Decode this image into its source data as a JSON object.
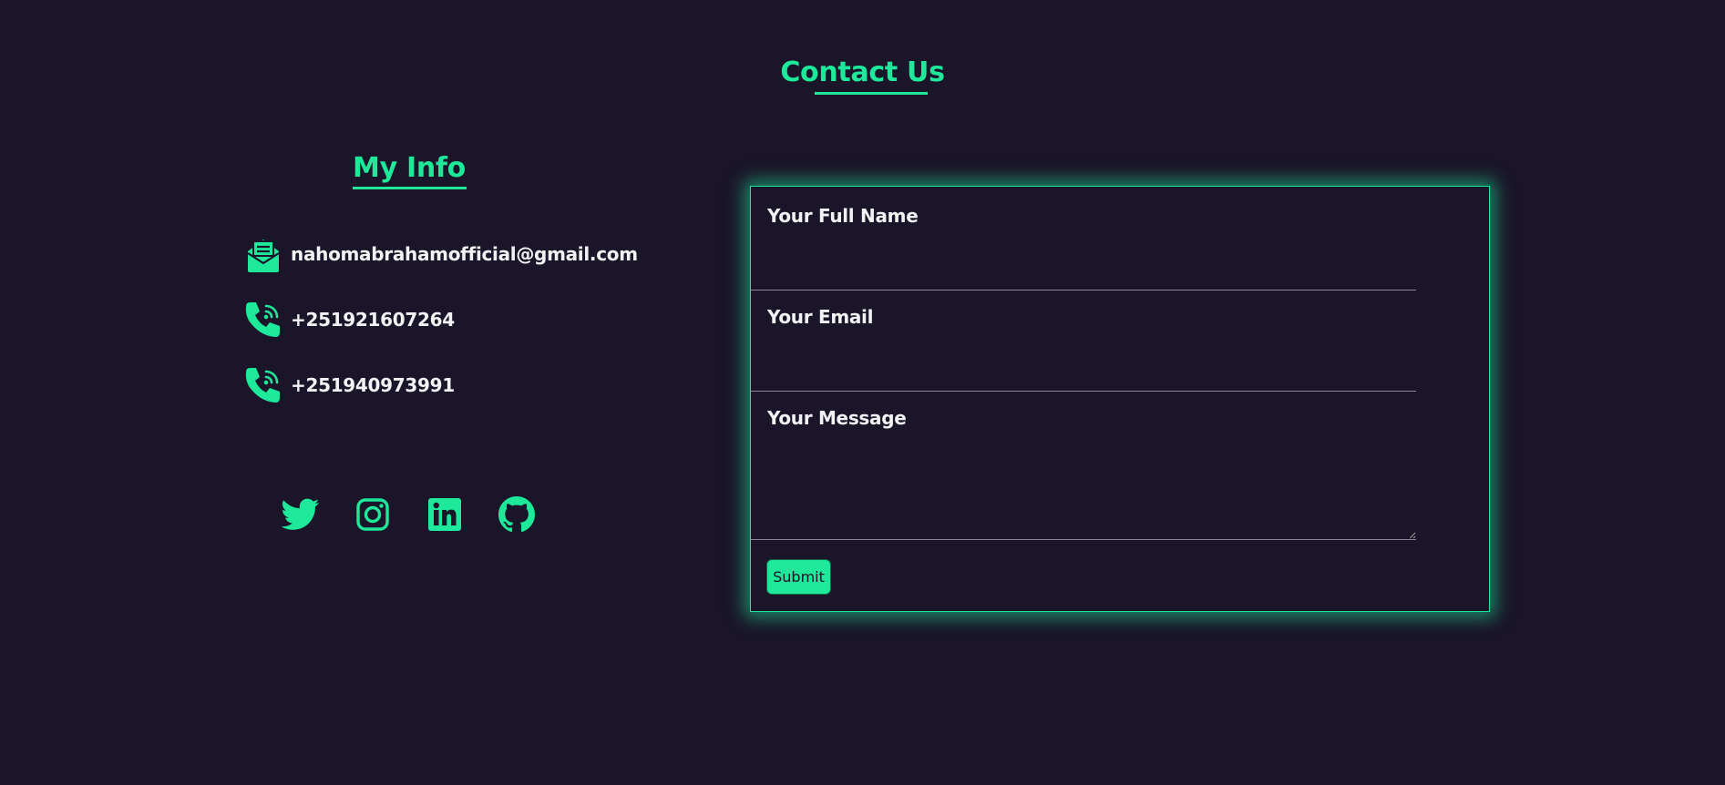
{
  "header": {
    "title": "Contact Us"
  },
  "info": {
    "title": "My Info",
    "items": [
      {
        "icon": "envelope-open-icon",
        "text": "nahomabrahamofficial@gmail.com"
      },
      {
        "icon": "phone-volume-icon",
        "text": "+251921607264"
      },
      {
        "icon": "phone-volume-icon",
        "text": "+251940973991"
      }
    ]
  },
  "socials": [
    {
      "icon": "twitter-icon"
    },
    {
      "icon": "instagram-icon"
    },
    {
      "icon": "linkedin-icon"
    },
    {
      "icon": "github-icon"
    }
  ],
  "form": {
    "name_label": "Your Full Name",
    "name_value": "",
    "email_label": "Your Email",
    "email_value": "",
    "message_label": "Your Message",
    "message_value": "",
    "submit_label": "Submit"
  },
  "colors": {
    "background": "#1a1528",
    "accent": "#1ee89a",
    "text": "#f2f2f5"
  }
}
